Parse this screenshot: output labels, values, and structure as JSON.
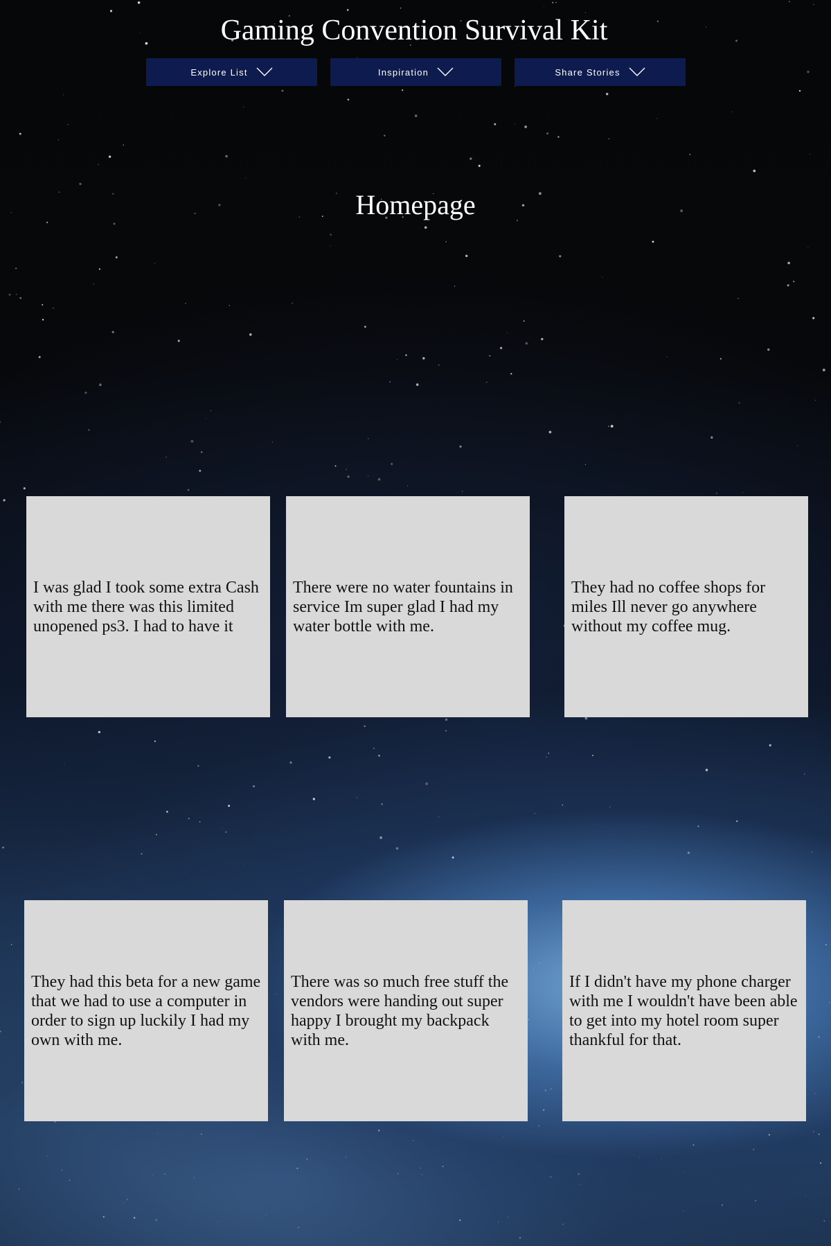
{
  "header": {
    "site_title": "Gaming Convention Survival Kit"
  },
  "nav": {
    "items": [
      {
        "label": "Explore List",
        "icon": "chevron-down-icon"
      },
      {
        "label": "Inspiration",
        "icon": "chevron-down-icon"
      },
      {
        "label": "Share Stories",
        "icon": "chevron-down-icon"
      }
    ],
    "background_color": "#0d1b4e",
    "text_color": "#ffffff"
  },
  "main": {
    "heading": "Homepage",
    "stories": [
      {
        "text": "I was glad I took some extra Cash with me there was this limited unopened ps3. I had to have it"
      },
      {
        "text": "There were no water fountains in service Im super glad I had my water bottle with me."
      },
      {
        "text": "They had no coffee shops for miles Ill never go anywhere without my coffee mug."
      },
      {
        "text": "They had this beta for a new game that we had to use a computer in order to sign up luckily I had my own with me."
      },
      {
        "text": "There was so much free stuff the vendors were handing out super happy I brought my backpack with me."
      },
      {
        "text": "If I didn't have my phone charger with me I wouldn't have been able to get into my hotel room super thankful for that."
      }
    ],
    "card_color": "#d9d9d9"
  },
  "background": {
    "theme": "space-earth-night"
  }
}
